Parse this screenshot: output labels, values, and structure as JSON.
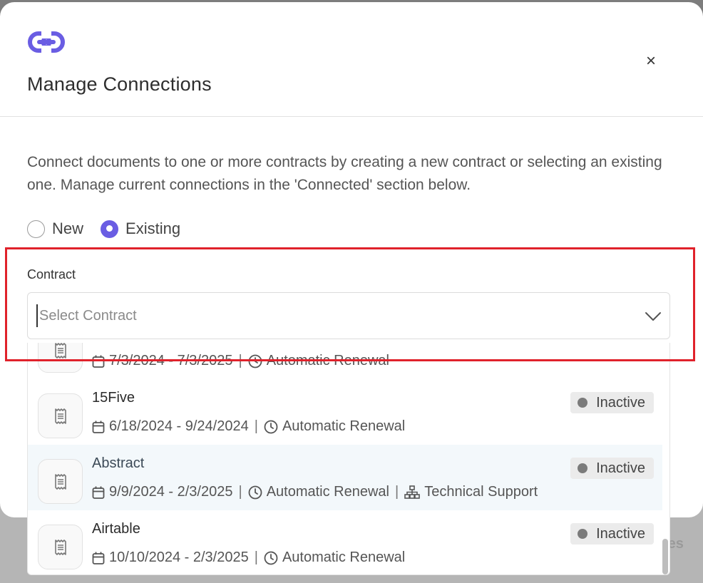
{
  "modal": {
    "title": "Manage Connections",
    "close_label": "×",
    "description": "Connect documents to one or more contracts by creating a new contract or selecting an existing one. Manage current connections in the 'Connected' section below."
  },
  "radio": {
    "new_label": "New",
    "existing_label": "Existing",
    "selected": "Existing"
  },
  "contract": {
    "label": "Contract",
    "placeholder": "Select Contract",
    "value": ""
  },
  "dropdown": {
    "items": [
      {
        "name": "",
        "dates": "7/3/2024 - 7/3/2025",
        "renewal": "Automatic Renewal",
        "category": "",
        "status": ""
      },
      {
        "name": "15Five",
        "dates": "6/18/2024 - 9/24/2024",
        "renewal": "Automatic Renewal",
        "category": "",
        "status": "Inactive"
      },
      {
        "name": "Abstract",
        "dates": "9/9/2024 - 2/3/2025",
        "renewal": "Automatic Renewal",
        "category": "Technical Support",
        "status": "Inactive"
      },
      {
        "name": "Airtable",
        "dates": "10/10/2024 - 2/3/2025",
        "renewal": "Automatic Renewal",
        "category": "",
        "status": "Inactive"
      }
    ]
  },
  "background": {
    "partial_text": "tes"
  },
  "colors": {
    "accent": "#6a5de3",
    "highlight": "#e0222b",
    "hover_row": "#f3f8fb"
  },
  "icons": [
    "link-icon",
    "close-icon",
    "chevron-down-icon",
    "receipt-icon",
    "calendar-icon",
    "clock-icon",
    "org-chart-icon"
  ]
}
